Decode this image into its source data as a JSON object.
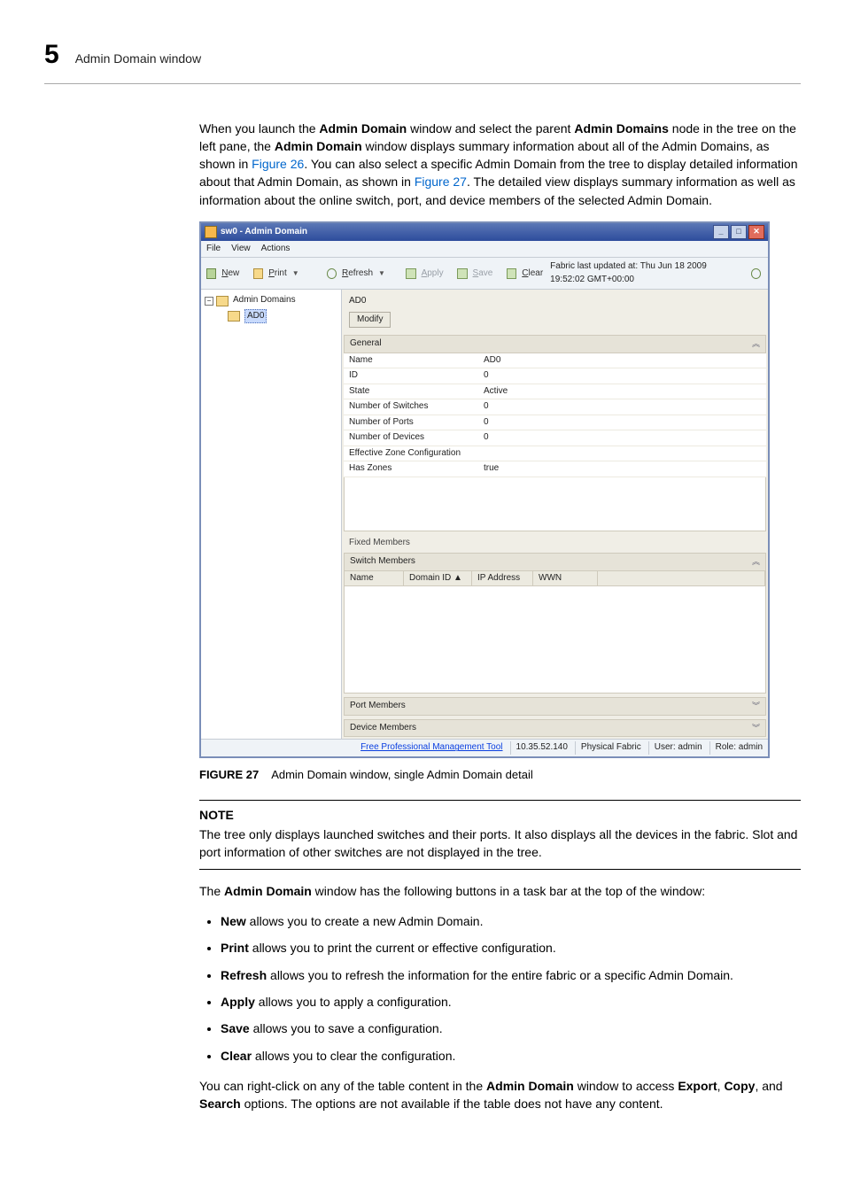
{
  "header": {
    "page_number": "5",
    "title": "Admin Domain window"
  },
  "intro": {
    "l1a": "When you launch the ",
    "l1b": "Admin Domain",
    "l1c": " window and select the parent ",
    "l1d": "Admin Domains",
    "l1e": " node in the tree on the left pane, the ",
    "l1f": "Admin Domain",
    "l1g": " window displays summary information about all of the Admin Domains, as shown in ",
    "link1": "Figure 26",
    "l1h": ". You can also select a specific Admin Domain from the tree to display detailed information about that Admin Domain, as shown in ",
    "link2": "Figure 27",
    "l1i": ". The detailed view displays summary information as well as information about the online switch, port, and device members of the selected Admin Domain."
  },
  "win": {
    "title": "sw0 - Admin Domain",
    "menu": {
      "file": "File",
      "view": "View",
      "actions": "Actions"
    },
    "toolbar": {
      "new": "New",
      "print": "Print",
      "refresh": "Refresh",
      "apply": "Apply",
      "save": "Save",
      "clear": "Clear",
      "fabric_status": "Fabric last updated at: Thu Jun 18 2009 19:52:02 GMT+00:00"
    },
    "tree": {
      "root": "Admin Domains",
      "child": "AD0"
    },
    "detail": {
      "heading": "AD0",
      "modify": "Modify",
      "general": "General",
      "rows": [
        {
          "k": "Name",
          "v": "AD0"
        },
        {
          "k": "ID",
          "v": "0"
        },
        {
          "k": "State",
          "v": "Active"
        },
        {
          "k": "Number of Switches",
          "v": "0"
        },
        {
          "k": "Number of Ports",
          "v": "0"
        },
        {
          "k": "Number of Devices",
          "v": "0"
        },
        {
          "k": "Effective Zone Configuration",
          "v": ""
        },
        {
          "k": "Has Zones",
          "v": "true"
        }
      ],
      "fixed_members": "Fixed Members",
      "switch_members": "Switch Members",
      "cols": {
        "name": "Name",
        "domain": "Domain ID ▲",
        "ip": "IP Address",
        "wwn": "WWN"
      },
      "port_members": "Port Members",
      "device_members": "Device Members"
    },
    "status": {
      "link": "Free Professional Management Tool",
      "ip": "10.35.52.140",
      "fabric": "Physical Fabric",
      "user": "User: admin",
      "role": "Role: admin"
    }
  },
  "figure": {
    "num": "FIGURE 27",
    "caption": "Admin Domain window, single Admin Domain detail"
  },
  "note": {
    "label": "NOTE",
    "text": "The tree only displays launched switches and their ports. It also displays all the devices in the fabric. Slot and port information of other switches are not displayed in the tree."
  },
  "para2": {
    "a": "The ",
    "b": "Admin Domain",
    "c": " window has the following buttons in a task bar at the top of the window:"
  },
  "bullets": [
    {
      "b": "New",
      "t": " allows you to create a new Admin Domain."
    },
    {
      "b": "Print",
      "t": " allows you to print the current or effective configuration."
    },
    {
      "b": "Refresh",
      "t": " allows you to refresh the information for the entire fabric or a specific Admin Domain."
    },
    {
      "b": "Apply",
      "t": " allows you to apply a configuration."
    },
    {
      "b": "Save",
      "t": " allows you to save a configuration."
    },
    {
      "b": "Clear",
      "t": " allows you to clear the configuration."
    }
  ],
  "para3": {
    "a": "You can right-click on any of the table content in the ",
    "b": "Admin Domain",
    "c": " window to access ",
    "d": "Export",
    "e": ", ",
    "f": "Copy",
    "g": ", and ",
    "h": "Search",
    "i": " options. The options are not available if the table does not have any content."
  }
}
